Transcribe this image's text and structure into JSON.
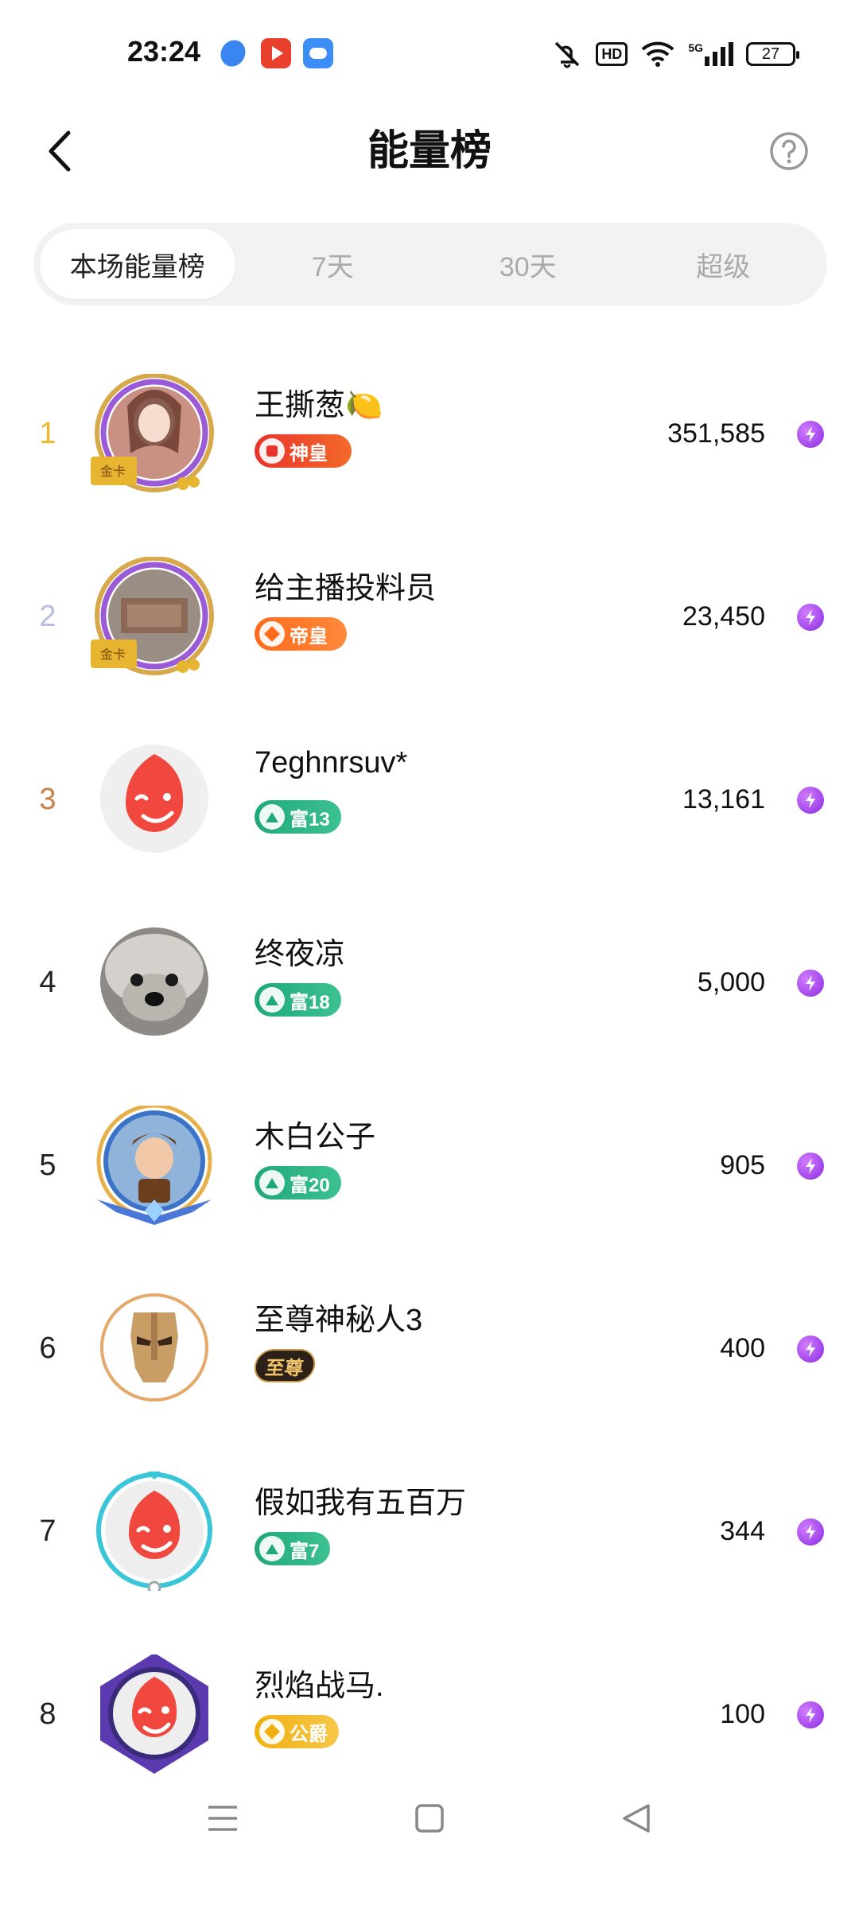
{
  "status_bar": {
    "time": "23:24",
    "notifications": [
      "app-notification-icon",
      "video-notification-icon",
      "weather-notification-icon"
    ],
    "hd_label": "HD",
    "network_label": "5G",
    "battery": "27"
  },
  "header": {
    "title": "能量榜",
    "back_icon": "chevron-left-icon",
    "help_icon": "help-icon"
  },
  "tabs": [
    {
      "label": "本场能量榜",
      "active": true
    },
    {
      "label": "7天",
      "active": false
    },
    {
      "label": "30天",
      "active": false
    },
    {
      "label": "超级",
      "active": false
    }
  ],
  "rank_colors": {
    "1": "#f0b429",
    "2": "#b8bde0",
    "3": "#c9824a"
  },
  "ranking": [
    {
      "rank": "1",
      "name": "王撕葱🍋",
      "badge": "神皇",
      "badge_type": "god",
      "score": "351,585",
      "frame": "gold-card-frame"
    },
    {
      "rank": "2",
      "name": "给主播投料员",
      "badge": "帝皇",
      "badge_type": "emperor",
      "score": "23,450",
      "frame": "gold-card-frame"
    },
    {
      "rank": "3",
      "name": "7eghnrsuv*",
      "badge": "富13",
      "badge_type": "rich",
      "score": "13,161",
      "frame": "none"
    },
    {
      "rank": "4",
      "name": "终夜凉",
      "badge": "富18",
      "badge_type": "rich",
      "score": "5,000",
      "frame": "none"
    },
    {
      "rank": "5",
      "name": "木白公子",
      "badge": "富20",
      "badge_type": "rich",
      "score": "905",
      "frame": "blue-wing-frame"
    },
    {
      "rank": "6",
      "name": "至尊神秘人3",
      "badge": "至尊",
      "badge_type": "supreme",
      "score": "400",
      "frame": "gold-ring-frame"
    },
    {
      "rank": "7",
      "name": "假如我有五百万",
      "badge": "富7",
      "badge_type": "rich",
      "score": "344",
      "frame": "cyan-frame"
    },
    {
      "rank": "8",
      "name": "烈焰战马.",
      "badge": "公爵",
      "badge_type": "duke",
      "score": "100",
      "frame": "purple-crystal-frame"
    }
  ],
  "energy_icon": "lightning-icon",
  "nav": {
    "menu_icon": "menu-icon",
    "home_icon": "home-square-icon",
    "back_icon": "back-triangle-icon"
  }
}
